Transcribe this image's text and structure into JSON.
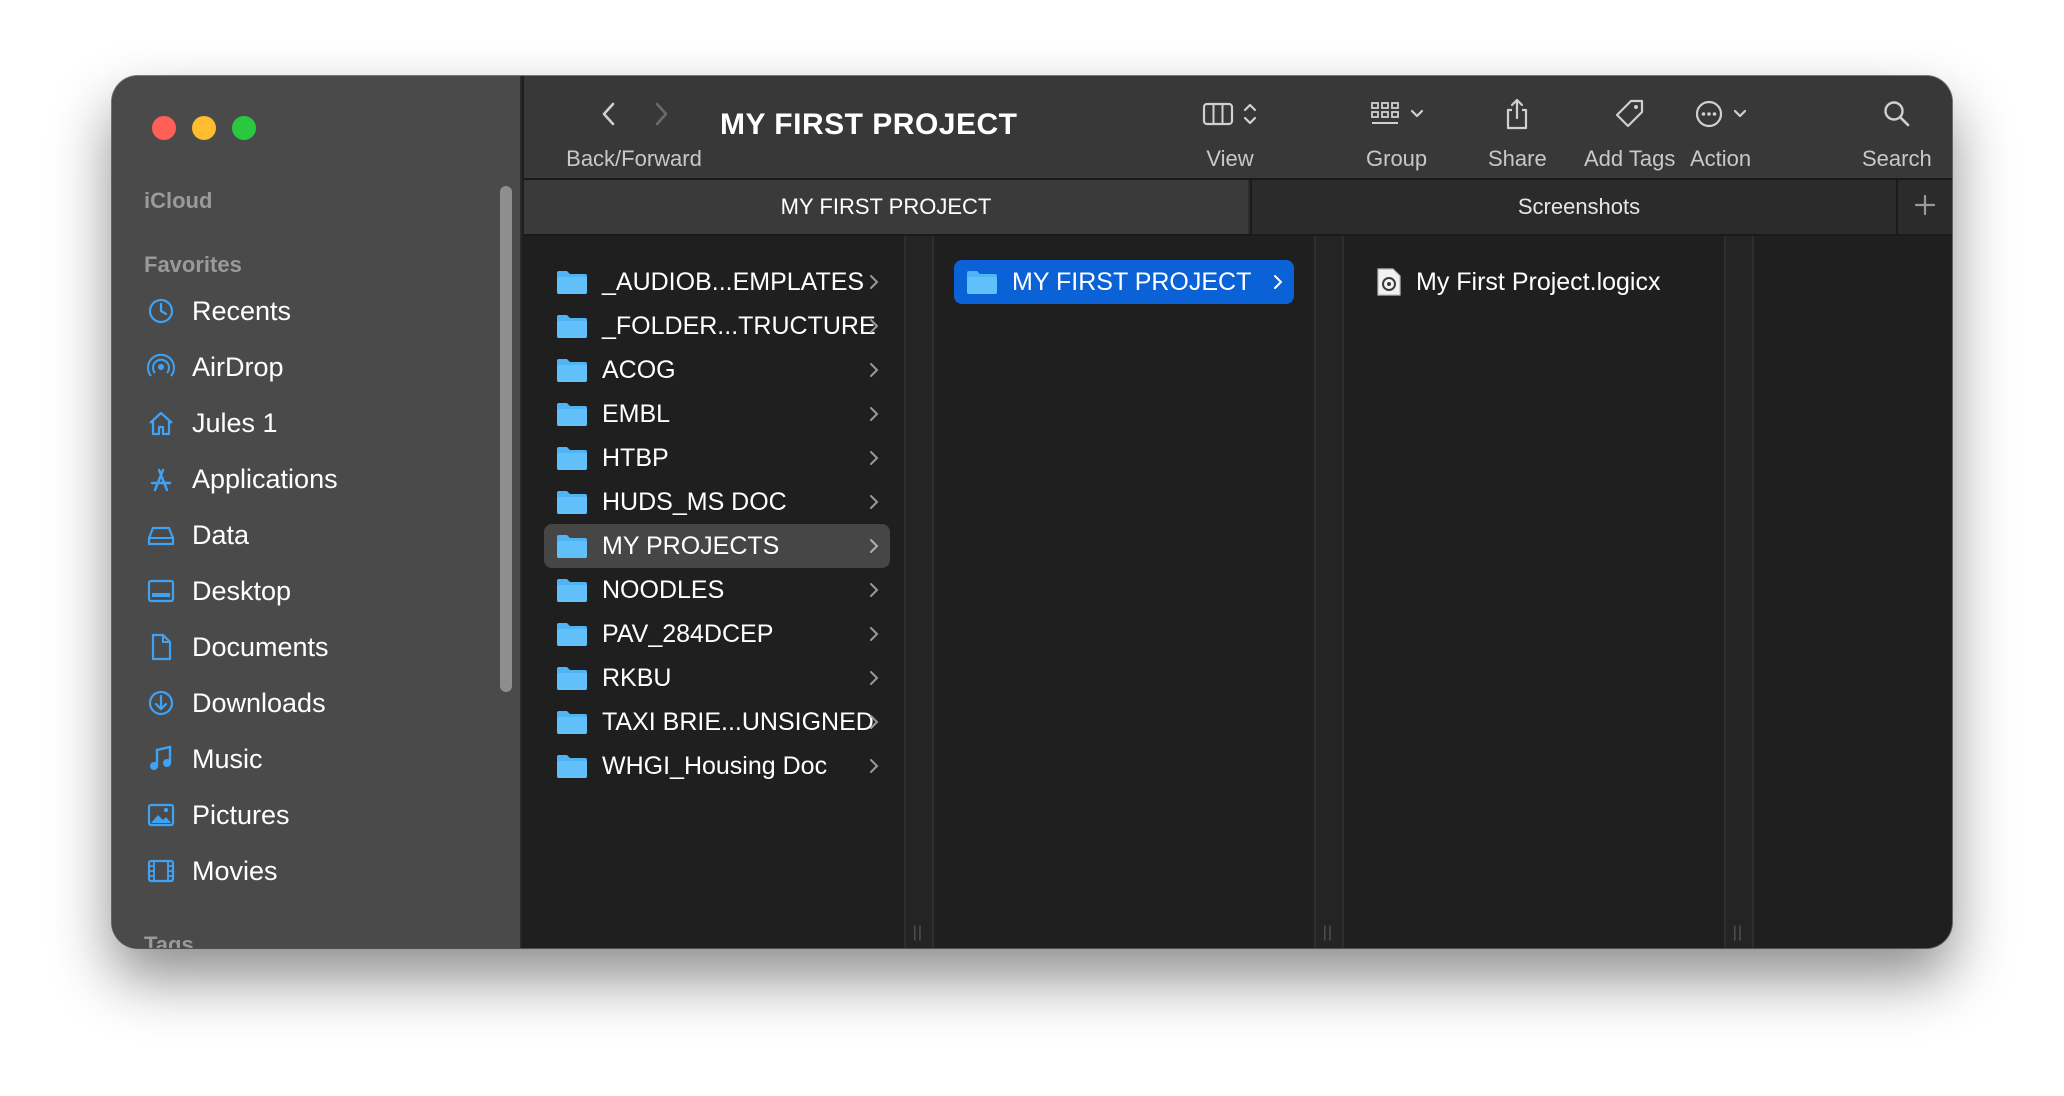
{
  "window": {
    "title": "MY FIRST PROJECT"
  },
  "toolbar": {
    "back_forward_label": "Back/Forward",
    "view_label": "View",
    "group_label": "Group",
    "share_label": "Share",
    "add_tags_label": "Add Tags",
    "action_label": "Action",
    "search_label": "Search"
  },
  "sidebar": {
    "icloud_label": "iCloud",
    "favorites_label": "Favorites",
    "tags_label": "Tags",
    "items": [
      {
        "label": "Recents",
        "icon": "clock-icon"
      },
      {
        "label": "AirDrop",
        "icon": "airdrop-icon"
      },
      {
        "label": "Jules 1",
        "icon": "home-icon"
      },
      {
        "label": "Applications",
        "icon": "applications-icon"
      },
      {
        "label": "Data",
        "icon": "drive-icon"
      },
      {
        "label": "Desktop",
        "icon": "desktop-icon"
      },
      {
        "label": "Documents",
        "icon": "document-icon"
      },
      {
        "label": "Downloads",
        "icon": "download-icon"
      },
      {
        "label": "Music",
        "icon": "music-icon"
      },
      {
        "label": "Pictures",
        "icon": "pictures-icon"
      },
      {
        "label": "Movies",
        "icon": "movies-icon"
      }
    ]
  },
  "tabs": [
    {
      "label": "MY FIRST PROJECT",
      "active": true
    },
    {
      "label": "Screenshots",
      "active": false
    }
  ],
  "columns": {
    "col1": [
      "_AUDIOB...EMPLATES",
      "_FOLDER...TRUCTURE",
      "ACOG",
      "EMBL",
      "HTBP",
      "HUDS_MS DOC",
      "MY PROJECTS",
      "NOODLES",
      "PAV_284DCEP",
      "RKBU",
      "TAXI BRIE...UNSIGNED",
      "WHGI_Housing Doc"
    ],
    "col1_highlighted": "MY PROJECTS",
    "col2": [
      "MY FIRST PROJECT"
    ],
    "col2_selected": "MY FIRST PROJECT",
    "col3": [
      "My First Project.logicx"
    ]
  },
  "colors": {
    "accent": "#0a62d6",
    "icon_blue": "#3fa3f5",
    "folder_blue": "#4fb3f5"
  }
}
